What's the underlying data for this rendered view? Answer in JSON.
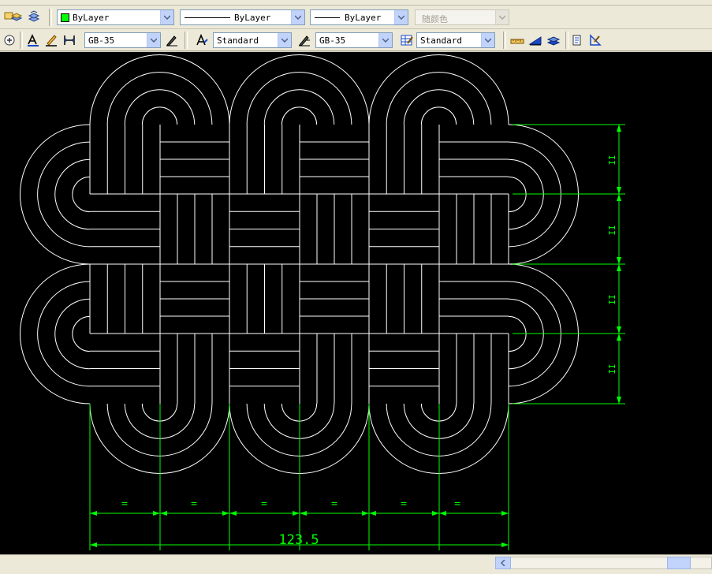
{
  "toolbar_layers": {
    "color_combo": "ByLayer",
    "linetype_combo": "ByLayer",
    "lineweight_combo": "ByLayer",
    "plotstyle_combo": "随颜色"
  },
  "toolbar_styles": {
    "dimstyle_combo": "GB-35",
    "textstyle_combo": "Standard",
    "dimstyle_combo_2": "GB-35",
    "tablestyle_combo": "Standard"
  },
  "drawing": {
    "total_dimension": "123.5",
    "equal_marker": "=",
    "equal_marker_vertical": "II"
  },
  "colors": {
    "canvas_bg": "#000000",
    "geometry": "#ffffff",
    "dimension": "#00ff00"
  }
}
